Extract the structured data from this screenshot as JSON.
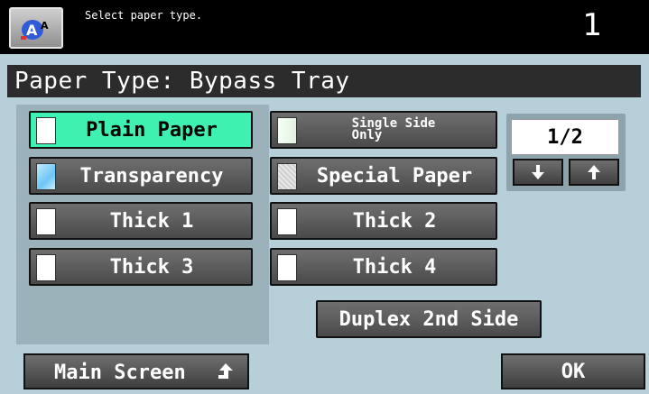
{
  "status": {
    "message": "Select paper type.",
    "counter": "1"
  },
  "title": "Paper Type: Bypass Tray",
  "paper_types": [
    {
      "label": "Plain Paper",
      "icon": "paper-icon",
      "selected": true
    },
    {
      "label": "Single Side\nOnly",
      "icon": "single-side-paper-icon",
      "selected": false
    },
    {
      "label": "Transparency",
      "icon": "transparency-icon",
      "selected": false
    },
    {
      "label": "Special Paper",
      "icon": "special-paper-icon",
      "selected": false
    },
    {
      "label": "Thick 1",
      "icon": "paper-icon",
      "selected": false
    },
    {
      "label": "Thick 2",
      "icon": "paper-icon",
      "selected": false
    },
    {
      "label": "Thick 3",
      "icon": "paper-icon",
      "selected": false
    },
    {
      "label": "Thick 4",
      "icon": "paper-icon",
      "selected": false
    }
  ],
  "pager": {
    "indicator": "1/2",
    "down_icon": "arrow-down-icon",
    "up_icon": "arrow-up-icon"
  },
  "duplex_label": "Duplex 2nd Side",
  "footer": {
    "main_screen_label": "Main Screen",
    "main_screen_icon": "return-arrow-icon",
    "ok_label": "OK"
  },
  "colors": {
    "selected": "#3ff1b0",
    "background": "#b6cfd8"
  }
}
